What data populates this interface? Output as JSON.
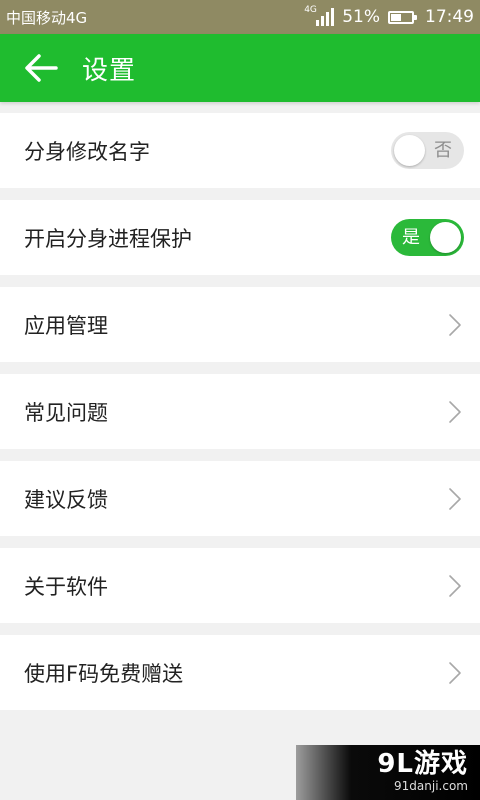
{
  "status_bar": {
    "carrier": "中国移动4G",
    "network_type": "4G",
    "battery_percent": "51%",
    "battery_level": 0.51,
    "time": "17:49"
  },
  "header": {
    "back_icon": "arrow-left-icon",
    "title": "设置"
  },
  "settings": {
    "items": [
      {
        "label": "分身修改名字",
        "type": "toggle",
        "toggle_on": false,
        "toggle_text": "否"
      },
      {
        "label": "开启分身进程保护",
        "type": "toggle",
        "toggle_on": true,
        "toggle_text": "是"
      },
      {
        "label": "应用管理",
        "type": "link",
        "icon": "chevron-right-icon"
      },
      {
        "label": "常见问题",
        "type": "link",
        "icon": "chevron-right-icon"
      },
      {
        "label": "建议反馈",
        "type": "link",
        "icon": "chevron-right-icon"
      },
      {
        "label": "关于软件",
        "type": "link",
        "icon": "chevron-right-icon"
      },
      {
        "label": "使用F码免费赠送",
        "type": "link",
        "icon": "chevron-right-icon"
      }
    ]
  },
  "watermark": {
    "logo": "9L游戏",
    "url": "91danji.com"
  },
  "colors": {
    "accent": "#1fbc2f",
    "toggle_on": "#2bb93a",
    "toggle_off": "#e6e6e6",
    "background": "#f1f1f1",
    "status_bar": "#8f8a63"
  }
}
